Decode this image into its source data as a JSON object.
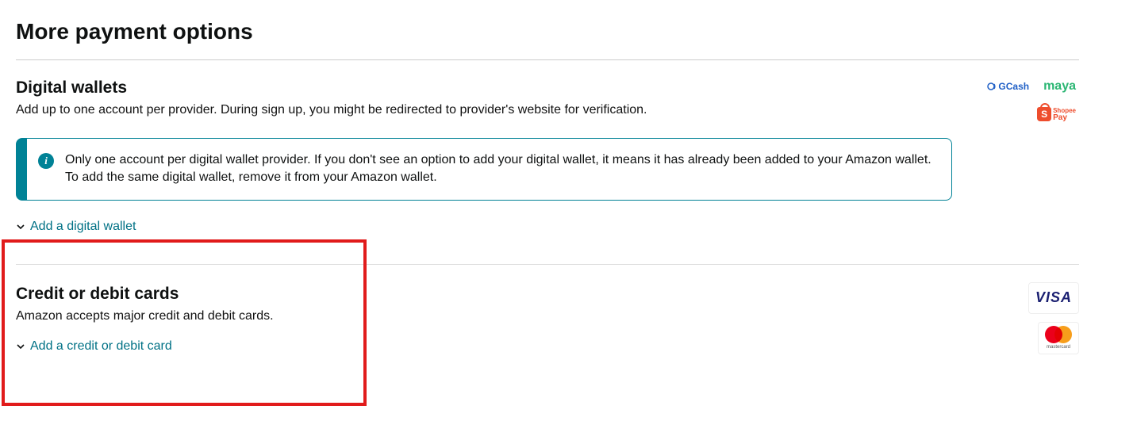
{
  "page_title": "More payment options",
  "digital_wallets": {
    "heading": "Digital wallets",
    "subtext": "Add up to one account per provider. During sign up, you might be redirected to provider's website for verification.",
    "alert_text": "Only one account per digital wallet provider. If you don't see an option to add your digital wallet, it means it has already been added to your Amazon wallet. To add the same digital wallet, remove it from your Amazon wallet.",
    "add_link": "Add a digital wallet",
    "providers": {
      "gcash": "GCash",
      "maya": "maya",
      "shopeepay_top": "Shopee",
      "shopeepay_bottom": "Pay"
    }
  },
  "cards": {
    "heading": "Credit or debit cards",
    "subtext": "Amazon accepts major credit and debit cards.",
    "add_link": "Add a credit or debit card",
    "brands": {
      "visa": "VISA",
      "mastercard": "mastercard"
    }
  }
}
